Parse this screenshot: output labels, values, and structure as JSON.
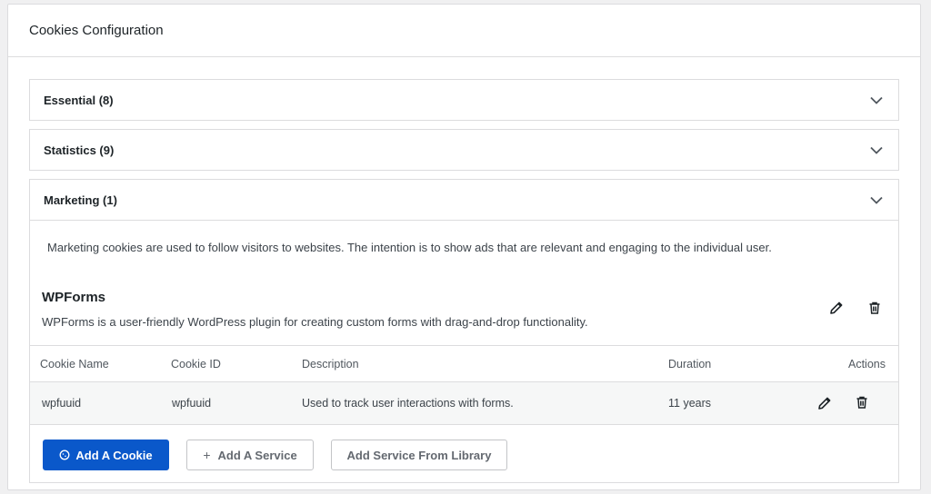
{
  "panel": {
    "title": "Cookies Configuration"
  },
  "categories": [
    {
      "label": "Essential (8)",
      "expanded": false
    },
    {
      "label": "Statistics (9)",
      "expanded": false
    },
    {
      "label": "Marketing (1)",
      "expanded": true,
      "description": "Marketing cookies are used to follow visitors to websites. The intention is to show ads that are relevant and engaging to the individual user."
    }
  ],
  "service": {
    "name": "WPForms",
    "description": "WPForms is a user-friendly WordPress plugin for creating custom forms with drag-and-drop functionality."
  },
  "table": {
    "headers": [
      "Cookie Name",
      "Cookie ID",
      "Description",
      "Duration",
      "Actions"
    ],
    "rows": [
      {
        "name": "wpfuuid",
        "id": "wpfuuid",
        "description": "Used to track user interactions with forms.",
        "duration": "11 years"
      }
    ]
  },
  "buttons": {
    "add_cookie": "Add A Cookie",
    "add_service": "Add A Service",
    "add_from_library": "Add Service From Library"
  },
  "icons": {
    "chevron": "chevron-down-icon",
    "edit": "pencil-icon",
    "delete": "trash-icon",
    "cookie": "cookie-icon",
    "plus": "plus-icon"
  },
  "colors": {
    "primary": "#0a58ca",
    "border": "#dcdcde",
    "row_bg": "#f6f7f7"
  }
}
